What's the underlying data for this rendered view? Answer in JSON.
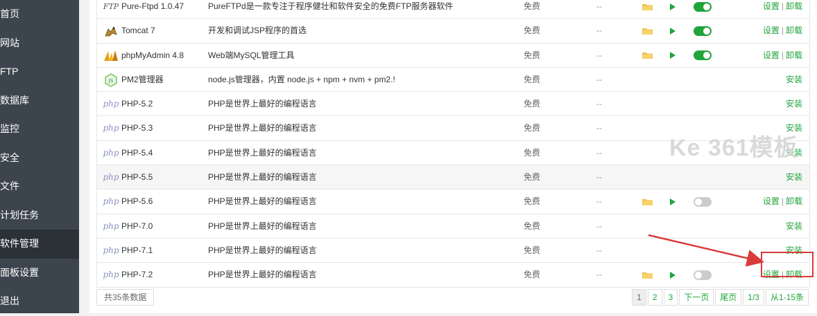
{
  "sidebar": {
    "items": [
      {
        "label": "首页"
      },
      {
        "label": "网站"
      },
      {
        "label": "FTP"
      },
      {
        "label": "数据库"
      },
      {
        "label": "监控"
      },
      {
        "label": "安全"
      },
      {
        "label": "文件"
      },
      {
        "label": "计划任务"
      },
      {
        "label": "软件管理"
      },
      {
        "label": "面板设置"
      },
      {
        "label": "退出"
      }
    ],
    "active_index": 8
  },
  "rows": [
    {
      "name": "Pure-Ftpd 1.0.47",
      "desc": "PureFTPd是一款专注于程序健壮和软件安全的免费FTP服务器软件",
      "price": "免费",
      "expire": "--",
      "installed": true,
      "running": true,
      "icon": "ftp-icon",
      "icon_text": "FTP"
    },
    {
      "name": "Tomcat 7",
      "desc": "开发和调试JSP程序的首选",
      "price": "免费",
      "expire": "--",
      "installed": true,
      "running": true,
      "icon": "tomcat-icon"
    },
    {
      "name": "phpMyAdmin 4.8",
      "desc": "Web端MySQL管理工具",
      "price": "免费",
      "expire": "--",
      "installed": true,
      "running": true,
      "icon": "phpmyadmin-icon"
    },
    {
      "name": "PM2管理器",
      "desc": "node.js管理器，内置 node.js + npm + nvm + pm2.!",
      "price": "免费",
      "expire": "--",
      "installed": false,
      "icon": "nodejs-icon"
    },
    {
      "name": "PHP-5.2",
      "desc": "PHP是世界上最好的编程语言",
      "price": "免费",
      "expire": "--",
      "installed": false,
      "icon": "php-icon",
      "icon_text": "php"
    },
    {
      "name": "PHP-5.3",
      "desc": "PHP是世界上最好的编程语言",
      "price": "免费",
      "expire": "--",
      "installed": false,
      "icon": "php-icon",
      "icon_text": "php"
    },
    {
      "name": "PHP-5.4",
      "desc": "PHP是世界上最好的编程语言",
      "price": "免费",
      "expire": "--",
      "installed": false,
      "icon": "php-icon",
      "icon_text": "php"
    },
    {
      "name": "PHP-5.5",
      "desc": "PHP是世界上最好的编程语言",
      "price": "免费",
      "expire": "--",
      "installed": false,
      "icon": "php-icon",
      "icon_text": "php"
    },
    {
      "name": "PHP-5.6",
      "desc": "PHP是世界上最好的编程语言",
      "price": "免费",
      "expire": "--",
      "installed": true,
      "running": false,
      "icon": "php-icon",
      "icon_text": "php"
    },
    {
      "name": "PHP-7.0",
      "desc": "PHP是世界上最好的编程语言",
      "price": "免费",
      "expire": "--",
      "installed": false,
      "icon": "php-icon",
      "icon_text": "php"
    },
    {
      "name": "PHP-7.1",
      "desc": "PHP是世界上最好的编程语言",
      "price": "免费",
      "expire": "--",
      "installed": false,
      "icon": "php-icon",
      "icon_text": "php"
    },
    {
      "name": "PHP-7.2",
      "desc": "PHP是世界上最好的编程语言",
      "price": "免费",
      "expire": "--",
      "installed": true,
      "running": false,
      "icon": "php-icon",
      "icon_text": "php"
    }
  ],
  "actions": {
    "settings": "设置",
    "uninstall": "卸载",
    "install": "安装",
    "separator": "|"
  },
  "footer": {
    "count": "共35条数据",
    "pages": [
      "1",
      "2",
      "3",
      "下一页",
      "尾页",
      "1/3",
      "从1-15条"
    ],
    "current_page_index": 0
  },
  "watermark": {
    "text": "Ke 361模板"
  },
  "colors": {
    "accent": "#20a53a",
    "sidebar": "#3c444d",
    "annotation": "#d93a3a"
  }
}
